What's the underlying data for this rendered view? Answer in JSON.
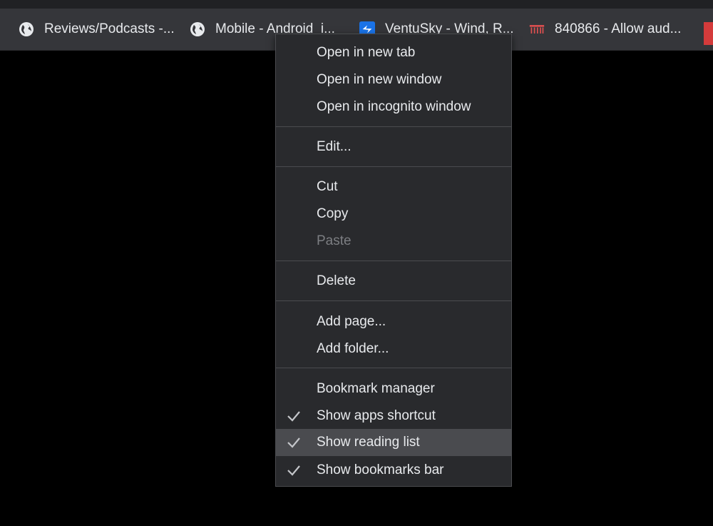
{
  "bookmarks_bar": {
    "items": [
      {
        "label": "Reviews/Podcasts -...",
        "icon": "globe-icon"
      },
      {
        "label": "Mobile - Android_i...",
        "icon": "globe-icon"
      },
      {
        "label": "VentuSky - Wind, R...",
        "icon": "ventusky-icon"
      },
      {
        "label": "840866 - Allow aud...",
        "icon": "chromium-bug-icon"
      }
    ]
  },
  "context_menu": {
    "open_new_tab": "Open in new tab",
    "open_new_window": "Open in new window",
    "open_incognito": "Open in incognito window",
    "edit": "Edit...",
    "cut": "Cut",
    "copy": "Copy",
    "paste": "Paste",
    "delete": "Delete",
    "add_page": "Add page...",
    "add_folder": "Add folder...",
    "bookmark_manager": "Bookmark manager",
    "show_apps_shortcut": "Show apps shortcut",
    "show_reading_list": "Show reading list",
    "show_bookmarks_bar": "Show bookmarks bar",
    "checked": {
      "show_apps_shortcut": true,
      "show_reading_list": true,
      "show_bookmarks_bar": true
    },
    "disabled_items": [
      "Paste"
    ],
    "hovered_item": "Show reading list"
  },
  "colors": {
    "background": "#000000",
    "bar": "#35363a",
    "menu": "#292a2d",
    "text": "#e8eaed",
    "disabled_text": "#7c7e82",
    "hover": "#4a4b4f",
    "accent_blue": "#1a73e8",
    "bug_red": "#e05050"
  }
}
